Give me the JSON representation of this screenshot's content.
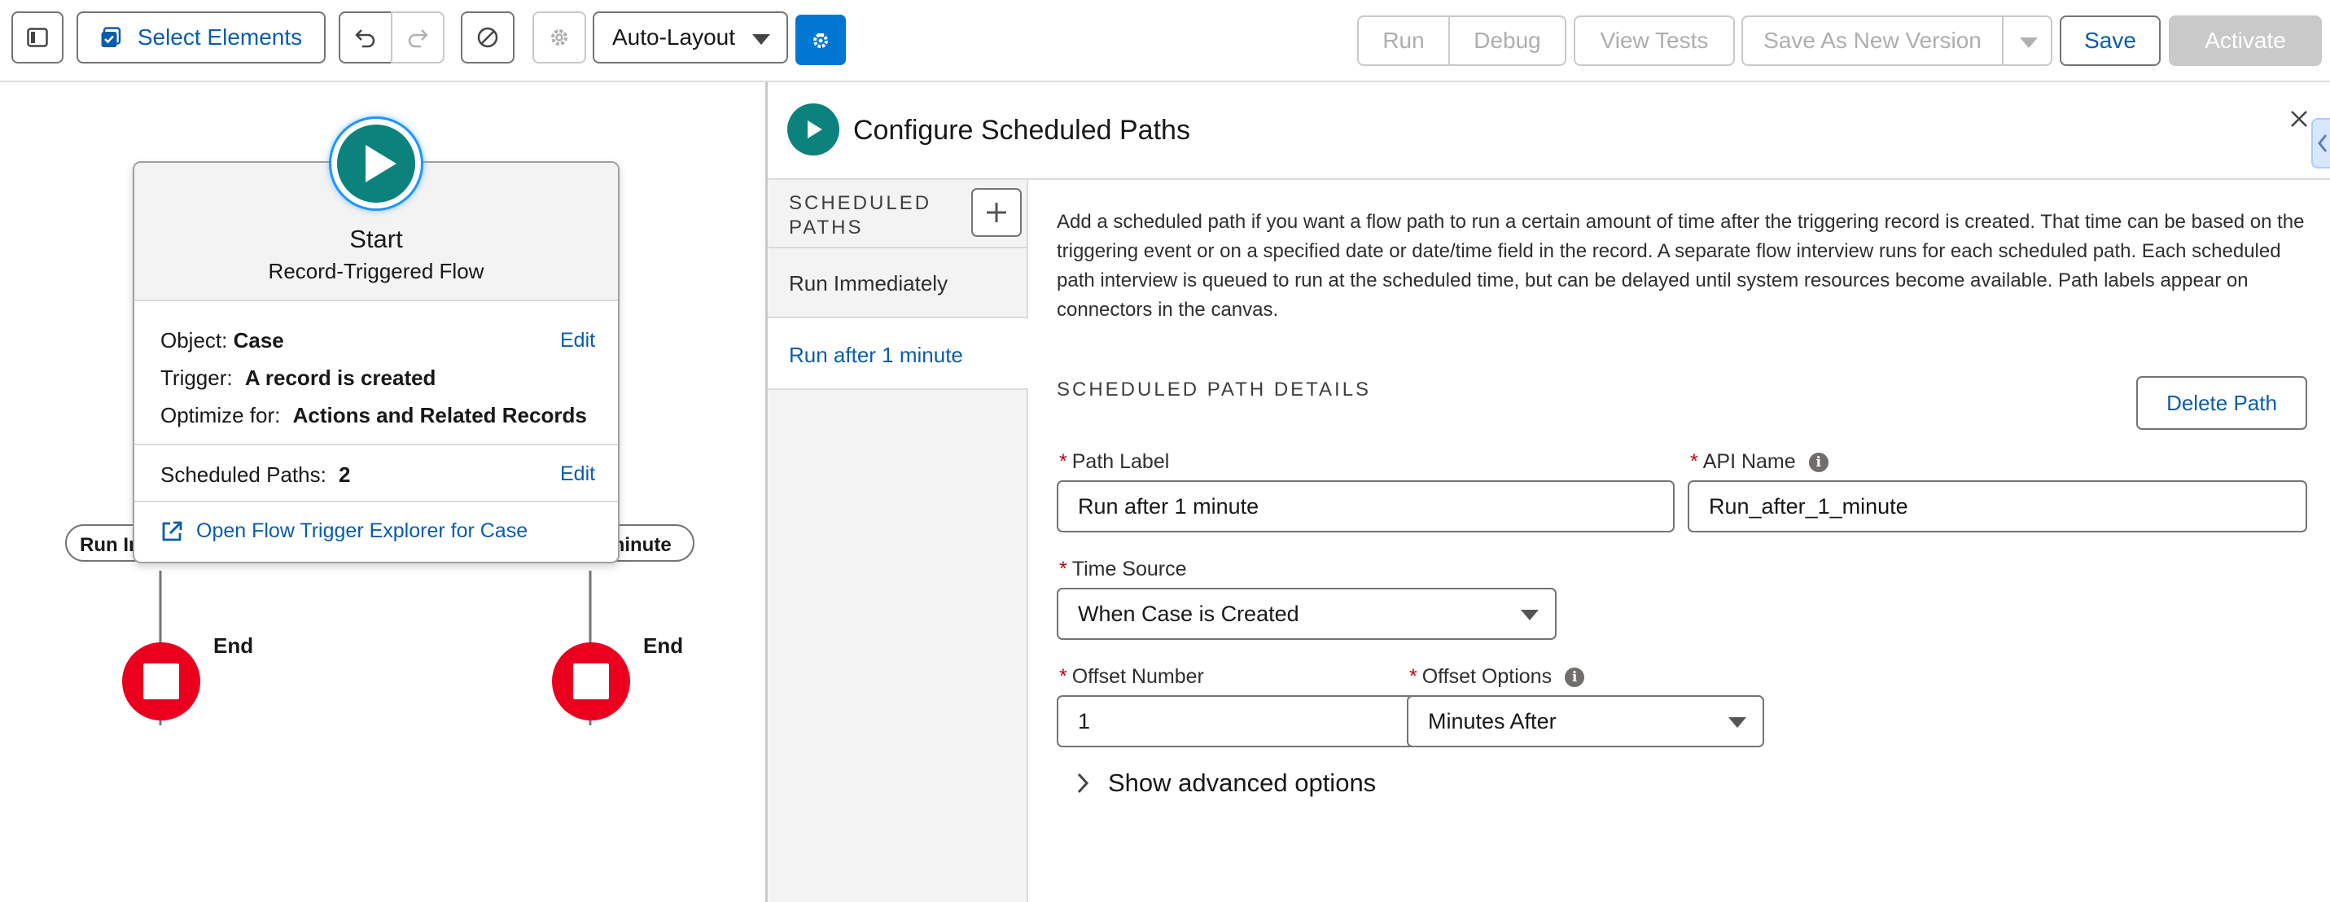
{
  "toolbar": {
    "select_elements_label": "Select Elements",
    "layout_value": "Auto-Layout",
    "run_label": "Run",
    "debug_label": "Debug",
    "view_tests_label": "View Tests",
    "save_as_new_version_label": "Save As New Version",
    "save_label": "Save",
    "activate_label": "Activate",
    "icons": [
      "sidebar-toggle-icon",
      "select-elements-icon",
      "undo-icon",
      "redo-icon",
      "ban-icon",
      "gear-icon",
      "layout-dropdown-icon",
      "flow-settings-icon",
      "save-dropdown-icon"
    ]
  },
  "canvas": {
    "start_title": "Start",
    "start_subtitle": "Record-Triggered Flow",
    "object_label": "Object:",
    "object_value": "Case",
    "object_edit_label": "Edit",
    "trigger_label": "Trigger:",
    "trigger_value": "A record is created",
    "optimize_label": "Optimize for:",
    "optimize_value": "Actions and Related Records",
    "scheduled_paths_label": "Scheduled Paths:",
    "scheduled_paths_value": "2",
    "scheduled_edit_label": "Edit",
    "open_explorer_label": "Open Flow Trigger Explorer for Case",
    "left_path_label": "Run Im",
    "right_path_label": "minute",
    "end_left_label": "End",
    "end_right_label": "End",
    "colors": {
      "start_node": "#0b827c",
      "end_node": "#ea001e",
      "link": "#0b5cab"
    }
  },
  "panel": {
    "title": "Configure Scheduled Paths",
    "sidebar_heading_line1": "SCHEDULED",
    "sidebar_heading_line2": "PATHS",
    "paths": [
      {
        "label": "Run Immediately",
        "selected": false
      },
      {
        "label": "Run after 1 minute",
        "selected": true
      }
    ],
    "description": "Add a scheduled path if you want a flow path to run a certain amount of time after the triggering record is created. That time can be based on the triggering event or on a specified date or date/time field in the record. A separate flow interview runs for each scheduled path. Each scheduled path interview is queued to run at the scheduled time, but can be delayed until system resources become available. Path labels appear on connectors in the canvas.",
    "section_heading": "SCHEDULED PATH DETAILS",
    "delete_path_label": "Delete Path",
    "path_label_label": "Path Label",
    "path_label_value": "Run after 1 minute",
    "api_name_label": "API Name",
    "api_name_value": "Run_after_1_minute",
    "time_source_label": "Time Source",
    "time_source_value": "When Case is Created",
    "offset_number_label": "Offset Number",
    "offset_number_value": "1",
    "offset_options_label": "Offset Options",
    "offset_options_value": "Minutes After",
    "advanced_options_label": "Show advanced options",
    "required_mark": "*"
  }
}
